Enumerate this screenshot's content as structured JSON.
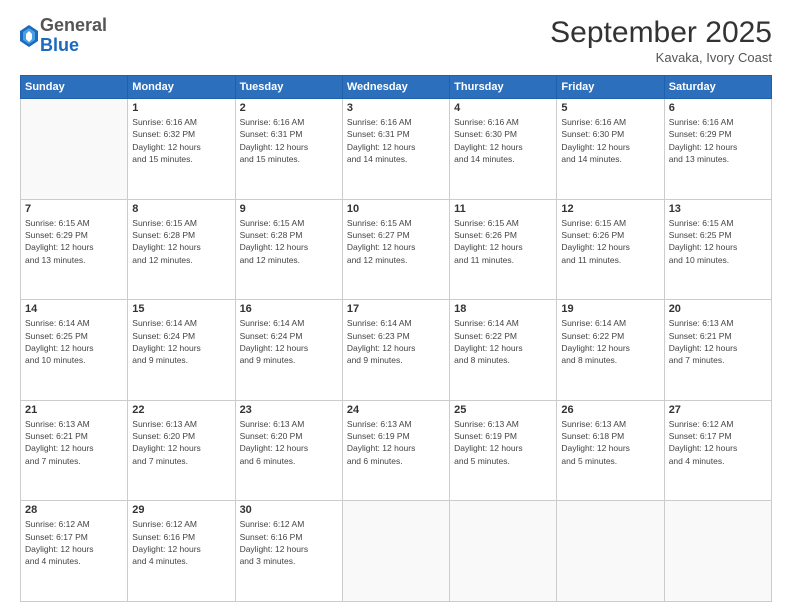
{
  "header": {
    "logo_general": "General",
    "logo_blue": "Blue",
    "month_title": "September 2025",
    "location": "Kavaka, Ivory Coast"
  },
  "days_of_week": [
    "Sunday",
    "Monday",
    "Tuesday",
    "Wednesday",
    "Thursday",
    "Friday",
    "Saturday"
  ],
  "weeks": [
    [
      {
        "day": "",
        "info": ""
      },
      {
        "day": "1",
        "info": "Sunrise: 6:16 AM\nSunset: 6:32 PM\nDaylight: 12 hours\nand 15 minutes."
      },
      {
        "day": "2",
        "info": "Sunrise: 6:16 AM\nSunset: 6:31 PM\nDaylight: 12 hours\nand 15 minutes."
      },
      {
        "day": "3",
        "info": "Sunrise: 6:16 AM\nSunset: 6:31 PM\nDaylight: 12 hours\nand 14 minutes."
      },
      {
        "day": "4",
        "info": "Sunrise: 6:16 AM\nSunset: 6:30 PM\nDaylight: 12 hours\nand 14 minutes."
      },
      {
        "day": "5",
        "info": "Sunrise: 6:16 AM\nSunset: 6:30 PM\nDaylight: 12 hours\nand 14 minutes."
      },
      {
        "day": "6",
        "info": "Sunrise: 6:16 AM\nSunset: 6:29 PM\nDaylight: 12 hours\nand 13 minutes."
      }
    ],
    [
      {
        "day": "7",
        "info": "Sunrise: 6:15 AM\nSunset: 6:29 PM\nDaylight: 12 hours\nand 13 minutes."
      },
      {
        "day": "8",
        "info": "Sunrise: 6:15 AM\nSunset: 6:28 PM\nDaylight: 12 hours\nand 12 minutes."
      },
      {
        "day": "9",
        "info": "Sunrise: 6:15 AM\nSunset: 6:28 PM\nDaylight: 12 hours\nand 12 minutes."
      },
      {
        "day": "10",
        "info": "Sunrise: 6:15 AM\nSunset: 6:27 PM\nDaylight: 12 hours\nand 12 minutes."
      },
      {
        "day": "11",
        "info": "Sunrise: 6:15 AM\nSunset: 6:26 PM\nDaylight: 12 hours\nand 11 minutes."
      },
      {
        "day": "12",
        "info": "Sunrise: 6:15 AM\nSunset: 6:26 PM\nDaylight: 12 hours\nand 11 minutes."
      },
      {
        "day": "13",
        "info": "Sunrise: 6:15 AM\nSunset: 6:25 PM\nDaylight: 12 hours\nand 10 minutes."
      }
    ],
    [
      {
        "day": "14",
        "info": "Sunrise: 6:14 AM\nSunset: 6:25 PM\nDaylight: 12 hours\nand 10 minutes."
      },
      {
        "day": "15",
        "info": "Sunrise: 6:14 AM\nSunset: 6:24 PM\nDaylight: 12 hours\nand 9 minutes."
      },
      {
        "day": "16",
        "info": "Sunrise: 6:14 AM\nSunset: 6:24 PM\nDaylight: 12 hours\nand 9 minutes."
      },
      {
        "day": "17",
        "info": "Sunrise: 6:14 AM\nSunset: 6:23 PM\nDaylight: 12 hours\nand 9 minutes."
      },
      {
        "day": "18",
        "info": "Sunrise: 6:14 AM\nSunset: 6:22 PM\nDaylight: 12 hours\nand 8 minutes."
      },
      {
        "day": "19",
        "info": "Sunrise: 6:14 AM\nSunset: 6:22 PM\nDaylight: 12 hours\nand 8 minutes."
      },
      {
        "day": "20",
        "info": "Sunrise: 6:13 AM\nSunset: 6:21 PM\nDaylight: 12 hours\nand 7 minutes."
      }
    ],
    [
      {
        "day": "21",
        "info": "Sunrise: 6:13 AM\nSunset: 6:21 PM\nDaylight: 12 hours\nand 7 minutes."
      },
      {
        "day": "22",
        "info": "Sunrise: 6:13 AM\nSunset: 6:20 PM\nDaylight: 12 hours\nand 7 minutes."
      },
      {
        "day": "23",
        "info": "Sunrise: 6:13 AM\nSunset: 6:20 PM\nDaylight: 12 hours\nand 6 minutes."
      },
      {
        "day": "24",
        "info": "Sunrise: 6:13 AM\nSunset: 6:19 PM\nDaylight: 12 hours\nand 6 minutes."
      },
      {
        "day": "25",
        "info": "Sunrise: 6:13 AM\nSunset: 6:19 PM\nDaylight: 12 hours\nand 5 minutes."
      },
      {
        "day": "26",
        "info": "Sunrise: 6:13 AM\nSunset: 6:18 PM\nDaylight: 12 hours\nand 5 minutes."
      },
      {
        "day": "27",
        "info": "Sunrise: 6:12 AM\nSunset: 6:17 PM\nDaylight: 12 hours\nand 4 minutes."
      }
    ],
    [
      {
        "day": "28",
        "info": "Sunrise: 6:12 AM\nSunset: 6:17 PM\nDaylight: 12 hours\nand 4 minutes."
      },
      {
        "day": "29",
        "info": "Sunrise: 6:12 AM\nSunset: 6:16 PM\nDaylight: 12 hours\nand 4 minutes."
      },
      {
        "day": "30",
        "info": "Sunrise: 6:12 AM\nSunset: 6:16 PM\nDaylight: 12 hours\nand 3 minutes."
      },
      {
        "day": "",
        "info": ""
      },
      {
        "day": "",
        "info": ""
      },
      {
        "day": "",
        "info": ""
      },
      {
        "day": "",
        "info": ""
      }
    ]
  ]
}
